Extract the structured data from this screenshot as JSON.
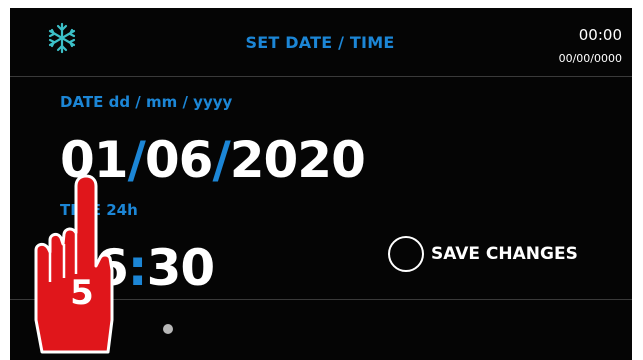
{
  "header": {
    "title": "SET DATE / TIME",
    "icon": "snowflake-icon",
    "clock_time": "00:00",
    "clock_date": "00/00/0000"
  },
  "date": {
    "label": "DATE dd / mm / yyyy",
    "day": "01",
    "month": "06",
    "year": "2020",
    "separator": "/"
  },
  "time": {
    "label": "TIME 24h",
    "hour": "16",
    "minute": "30",
    "separator": ":"
  },
  "save": {
    "label": "SAVE CHANGES"
  },
  "pointer": {
    "label": "5",
    "icon": "pointing-hand-icon"
  },
  "colors": {
    "background": "#050505",
    "accent": "#1c86d6",
    "text": "#ffffff",
    "pointer": "#e0161b"
  }
}
